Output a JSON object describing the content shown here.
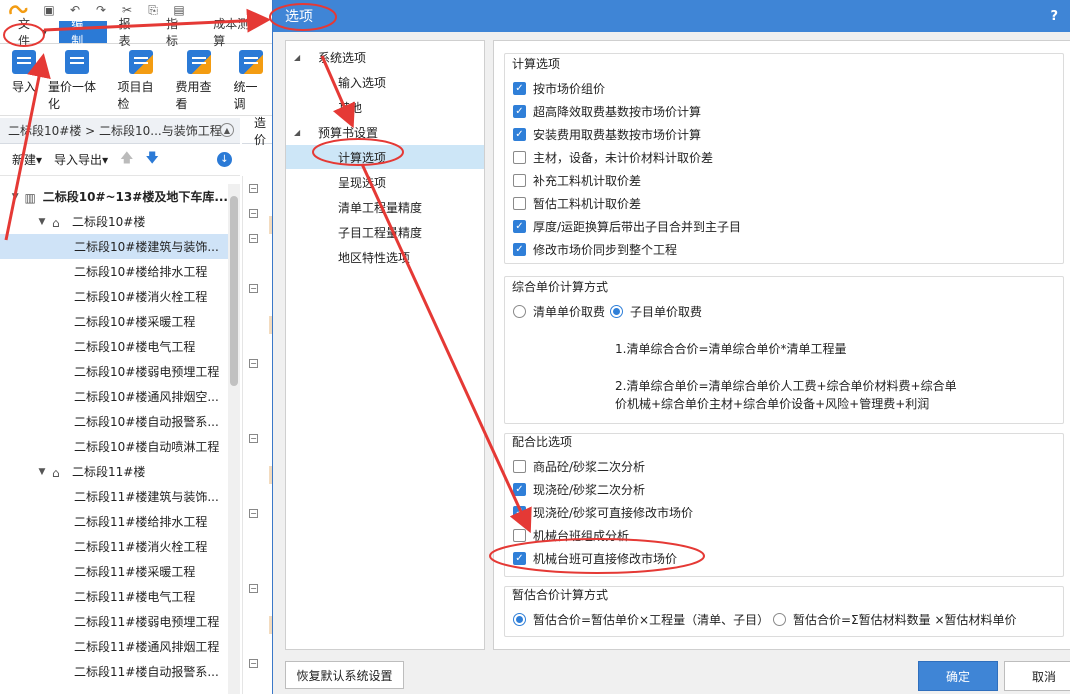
{
  "app": {
    "menus": [
      "文件",
      "编制",
      "报表",
      "指标",
      "成本测算"
    ],
    "active_menu_index": 1,
    "ribbon": [
      "导入",
      "量价一体化",
      "项目自检",
      "费用查看",
      "统一调"
    ],
    "breadcrumb": "二标段10#楼 > 二标段10...与装饰工程",
    "cost_tab": "造价",
    "toolbar": {
      "new": "新建",
      "import_export": "导入导出"
    },
    "tree": [
      {
        "label": "二标段10#~13#楼及地下车库...",
        "level": 0,
        "type": "project"
      },
      {
        "label": "二标段10#楼",
        "level": 1,
        "type": "building"
      },
      {
        "label": "二标段10#楼建筑与装饰...",
        "level": 2,
        "type": "unit",
        "selected": true
      },
      {
        "label": "二标段10#楼给排水工程",
        "level": 2,
        "type": "unit"
      },
      {
        "label": "二标段10#楼消火栓工程",
        "level": 2,
        "type": "unit"
      },
      {
        "label": "二标段10#楼采暖工程",
        "level": 2,
        "type": "unit"
      },
      {
        "label": "二标段10#楼电气工程",
        "level": 2,
        "type": "unit"
      },
      {
        "label": "二标段10#楼弱电预埋工程",
        "level": 2,
        "type": "unit"
      },
      {
        "label": "二标段10#楼通风排烟空...",
        "level": 2,
        "type": "unit"
      },
      {
        "label": "二标段10#楼自动报警系...",
        "level": 2,
        "type": "unit"
      },
      {
        "label": "二标段10#楼自动喷淋工程",
        "level": 2,
        "type": "unit"
      },
      {
        "label": "二标段11#楼",
        "level": 1,
        "type": "building"
      },
      {
        "label": "二标段11#楼建筑与装饰...",
        "level": 2,
        "type": "unit"
      },
      {
        "label": "二标段11#楼给排水工程",
        "level": 2,
        "type": "unit"
      },
      {
        "label": "二标段11#楼消火栓工程",
        "level": 2,
        "type": "unit"
      },
      {
        "label": "二标段11#楼采暖工程",
        "level": 2,
        "type": "unit"
      },
      {
        "label": "二标段11#楼电气工程",
        "level": 2,
        "type": "unit"
      },
      {
        "label": "二标段11#楼弱电预埋工程",
        "level": 2,
        "type": "unit"
      },
      {
        "label": "二标段11#楼通风排烟工程",
        "level": 2,
        "type": "unit"
      },
      {
        "label": "二标段11#楼自动报警系...",
        "level": 2,
        "type": "unit"
      }
    ]
  },
  "dialog": {
    "title": "选项",
    "help": "?",
    "nav": [
      {
        "label": "系统选项",
        "level": 0,
        "expander": true
      },
      {
        "label": "输入选项",
        "level": 1
      },
      {
        "label": "其他",
        "level": 1
      },
      {
        "label": "预算书设置",
        "level": 0,
        "expander": true
      },
      {
        "label": "计算选项",
        "level": 1,
        "selected": true
      },
      {
        "label": "呈现选项",
        "level": 1
      },
      {
        "label": "清单工程量精度",
        "level": 1
      },
      {
        "label": "子目工程量精度",
        "level": 1
      },
      {
        "label": "地区特性选项",
        "level": 1
      }
    ],
    "calc": {
      "title": "计算选项",
      "options": [
        {
          "label": "按市场价组价",
          "checked": true
        },
        {
          "label": "超高降效取费基数按市场价计算",
          "checked": true
        },
        {
          "label": "安装费用取费基数按市场价计算",
          "checked": true
        },
        {
          "label": "主材，设备，未计价材料计取价差",
          "checked": false
        },
        {
          "label": "补充工料机计取价差",
          "checked": false
        },
        {
          "label": "暂估工料机计取价差",
          "checked": false
        },
        {
          "label": "厚度/运距换算后带出子目合并到主子目",
          "checked": true
        },
        {
          "label": "修改市场价同步到整个工程",
          "checked": true
        }
      ]
    },
    "unit_price": {
      "title": "综合单价计算方式",
      "radios": [
        {
          "label": "清单单价取费",
          "selected": false
        },
        {
          "label": "子目单价取费",
          "selected": true
        }
      ],
      "desc1": "1.清单综合合价=清单综合单价*清单工程量",
      "desc2a": "2.清单综合单价=清单综合单价人工费+综合单价材料费+综合单",
      "desc2b": "价机械+综合单价主材+综合单价设备+风险+管理费+利润"
    },
    "mix": {
      "title": "配合比选项",
      "options": [
        {
          "label": "商品砼/砂浆二次分析",
          "checked": false
        },
        {
          "label": "现浇砼/砂浆二次分析",
          "checked": true
        },
        {
          "label": "现浇砼/砂浆可直接修改市场价",
          "checked": true
        },
        {
          "label": "机械台班组成分析",
          "checked": false
        },
        {
          "label": "机械台班可直接修改市场价",
          "checked": true
        }
      ]
    },
    "estimate": {
      "title": "暂估合价计算方式",
      "radios": [
        {
          "label": "暂估合价=暂估单价×工程量（清单、子目）",
          "selected": true
        },
        {
          "label": "暂估合价=Σ暂估材料数量 ×暂估材料单价",
          "selected": false
        }
      ]
    },
    "buttons": {
      "restore": "恢复默认系统设置",
      "ok": "确定",
      "cancel": "取消"
    }
  },
  "colors": {
    "accent": "#3f85d6",
    "checkbox_on": "#2f7fd8",
    "annotation": "#e53935",
    "selection": "#cde6f7"
  }
}
